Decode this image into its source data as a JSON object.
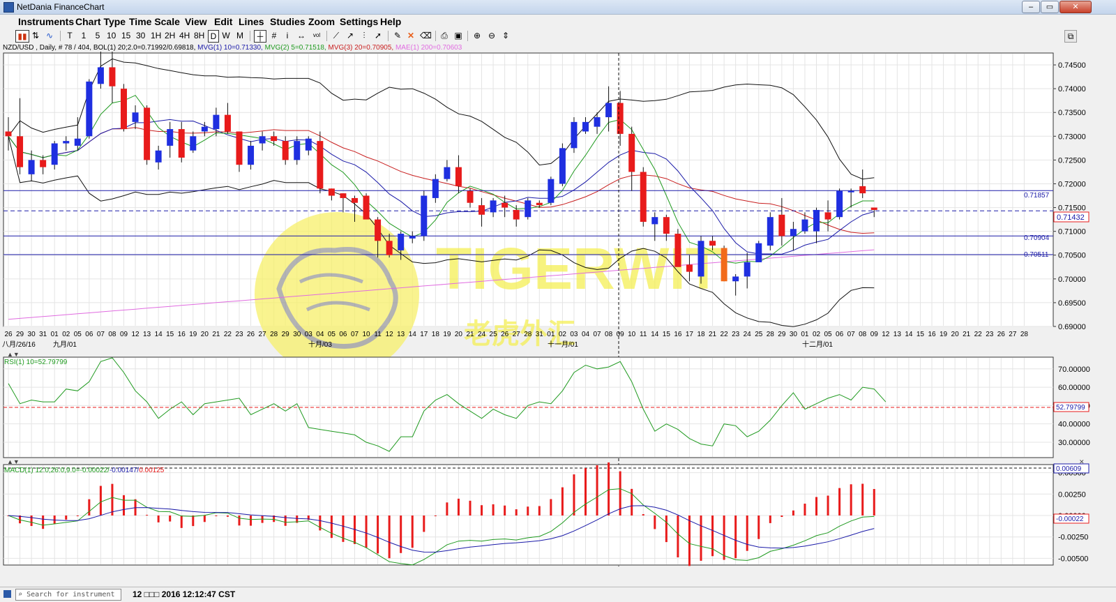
{
  "window": {
    "title": "NetDania FinanceChart",
    "buttons": [
      "–",
      "▭",
      "✕"
    ]
  },
  "menu": [
    "Instruments",
    "Chart Type",
    "Time Scale",
    "View",
    "Edit",
    "Lines",
    "Studies",
    "Zoom",
    "Settings",
    "Help"
  ],
  "toolbar": {
    "timeframes": [
      "T",
      "1",
      "5",
      "10",
      "15",
      "30",
      "1H",
      "2H",
      "4H",
      "8H",
      "D",
      "W",
      "M"
    ],
    "selected_timeframe": "D"
  },
  "legend": {
    "instrument": "NZD/USD , Daily, # 78 / 404, BOL(1) 20;2.0=0.71992/0.69818,",
    "mvg1": "MVG(1) 10=0.71330,",
    "mvg2": "MVG(2) 5=0.71518,",
    "mvg3": "MVG(3) 20=0.70905,",
    "mae": "MAE(1) 200=0.70603"
  },
  "colors": {
    "up_candle": "#1f2fe0",
    "down_candle": "#e81b1b",
    "orange_candle": "#f26b1b",
    "mvg1": "#1a1aa8",
    "mvg2": "#1f9a1f",
    "mvg3": "#c81e1e",
    "mae": "#e06be0",
    "boll": "#111111",
    "watermark": "#f5ef55"
  },
  "watermark": {
    "brand": "TIGERWIT",
    "subtitle": "老虎外汇"
  },
  "price_axis": {
    "ticks": [
      "0.74500",
      "0.74000",
      "0.73500",
      "0.73000",
      "0.72500",
      "0.72000",
      "0.71500",
      "0.71000",
      "0.70500",
      "0.70000",
      "0.69500",
      "0.69000"
    ],
    "current": "0.71432",
    "levels": [
      "0.71857",
      "0.70904",
      "0.70511"
    ]
  },
  "x_axis": {
    "days": [
      "26",
      "29",
      "30",
      "31",
      "01",
      "02",
      "05",
      "06",
      "07",
      "08",
      "09",
      "12",
      "13",
      "14",
      "15",
      "16",
      "19",
      "20",
      "21",
      "22",
      "23",
      "26",
      "27",
      "28",
      "29",
      "30",
      "03",
      "04",
      "05",
      "06",
      "07",
      "10",
      "11",
      "12",
      "13",
      "14",
      "17",
      "18",
      "19",
      "20",
      "21",
      "24",
      "25",
      "26",
      "27",
      "28",
      "31",
      "01",
      "02",
      "03",
      "04",
      "07",
      "08",
      "09",
      "10",
      "11",
      "14",
      "15",
      "16",
      "17",
      "18",
      "21",
      "22",
      "23",
      "24",
      "25",
      "28",
      "29",
      "30",
      "01",
      "02",
      "05",
      "06",
      "07",
      "08",
      "09",
      "12",
      "13",
      "14",
      "15",
      "16",
      "19",
      "20",
      "21",
      "22",
      "23",
      "26",
      "27",
      "28"
    ],
    "months": [
      "八月/26/16",
      "九月/01",
      "十月/03",
      "十一月/01",
      "十二月/01"
    ]
  },
  "rsi": {
    "label": "RSI(1) 10=52.79799",
    "ticks": [
      "70.00000",
      "60.00000",
      "50.00000",
      "40.00000",
      "30.00000"
    ],
    "current": "52.79799"
  },
  "macd": {
    "label_main": "MACD(1) 12.0,26.0,9.0=-0.00022/",
    "label_signal": "-0.00147/",
    "label_hist": "0.00125",
    "ticks": [
      "0.00500",
      "0.00250",
      "0.00000",
      "-0.00250",
      "-0.00500"
    ],
    "current_top": "0.00609",
    "current": "-0.00022"
  },
  "status": {
    "search_placeholder": "Search for instrument",
    "datetime": "12 □□□ 2016 12:12:47 CST"
  },
  "chart_data": {
    "type": "candlestick",
    "instrument": "NZD/USD",
    "timeframe": "Daily",
    "ylim": [
      0.69,
      0.7475
    ],
    "candles": [
      {
        "o": 0.731,
        "h": 0.734,
        "l": 0.727,
        "c": 0.73
      },
      {
        "o": 0.73,
        "h": 0.738,
        "l": 0.722,
        "c": 0.7235
      },
      {
        "o": 0.722,
        "h": 0.727,
        "l": 0.7205,
        "c": 0.725
      },
      {
        "o": 0.725,
        "h": 0.726,
        "l": 0.722,
        "c": 0.7235
      },
      {
        "o": 0.724,
        "h": 0.729,
        "l": 0.723,
        "c": 0.7285
      },
      {
        "o": 0.7285,
        "h": 0.73,
        "l": 0.727,
        "c": 0.729
      },
      {
        "o": 0.728,
        "h": 0.734,
        "l": 0.727,
        "c": 0.7295
      },
      {
        "o": 0.73,
        "h": 0.742,
        "l": 0.7295,
        "c": 0.7415
      },
      {
        "o": 0.741,
        "h": 0.7485,
        "l": 0.74,
        "c": 0.7445
      },
      {
        "o": 0.7445,
        "h": 0.7485,
        "l": 0.737,
        "c": 0.7405
      },
      {
        "o": 0.74,
        "h": 0.741,
        "l": 0.731,
        "c": 0.7315
      },
      {
        "o": 0.733,
        "h": 0.7365,
        "l": 0.7315,
        "c": 0.735
      },
      {
        "o": 0.736,
        "h": 0.7365,
        "l": 0.724,
        "c": 0.725
      },
      {
        "o": 0.7245,
        "h": 0.728,
        "l": 0.723,
        "c": 0.727
      },
      {
        "o": 0.728,
        "h": 0.733,
        "l": 0.7255,
        "c": 0.7315
      },
      {
        "o": 0.7315,
        "h": 0.733,
        "l": 0.7245,
        "c": 0.7255
      },
      {
        "o": 0.727,
        "h": 0.731,
        "l": 0.7265,
        "c": 0.73
      },
      {
        "o": 0.731,
        "h": 0.733,
        "l": 0.73,
        "c": 0.732
      },
      {
        "o": 0.7315,
        "h": 0.736,
        "l": 0.73,
        "c": 0.7345
      },
      {
        "o": 0.7345,
        "h": 0.737,
        "l": 0.7305,
        "c": 0.731
      },
      {
        "o": 0.731,
        "h": 0.731,
        "l": 0.7225,
        "c": 0.724
      },
      {
        "o": 0.724,
        "h": 0.729,
        "l": 0.723,
        "c": 0.728
      },
      {
        "o": 0.7285,
        "h": 0.731,
        "l": 0.727,
        "c": 0.73
      },
      {
        "o": 0.73,
        "h": 0.731,
        "l": 0.728,
        "c": 0.729
      },
      {
        "o": 0.729,
        "h": 0.73,
        "l": 0.724,
        "c": 0.725
      },
      {
        "o": 0.725,
        "h": 0.73,
        "l": 0.724,
        "c": 0.729
      },
      {
        "o": 0.727,
        "h": 0.73,
        "l": 0.726,
        "c": 0.7295
      },
      {
        "o": 0.729,
        "h": 0.731,
        "l": 0.718,
        "c": 0.719
      },
      {
        "o": 0.719,
        "h": 0.719,
        "l": 0.7165,
        "c": 0.7175
      },
      {
        "o": 0.718,
        "h": 0.718,
        "l": 0.714,
        "c": 0.717
      },
      {
        "o": 0.717,
        "h": 0.7175,
        "l": 0.712,
        "c": 0.716
      },
      {
        "o": 0.7175,
        "h": 0.718,
        "l": 0.713,
        "c": 0.7125
      },
      {
        "o": 0.7125,
        "h": 0.713,
        "l": 0.7045,
        "c": 0.708
      },
      {
        "o": 0.708,
        "h": 0.7095,
        "l": 0.7045,
        "c": 0.705
      },
      {
        "o": 0.706,
        "h": 0.71,
        "l": 0.704,
        "c": 0.7095
      },
      {
        "o": 0.7085,
        "h": 0.71,
        "l": 0.7075,
        "c": 0.709
      },
      {
        "o": 0.709,
        "h": 0.7185,
        "l": 0.708,
        "c": 0.7175
      },
      {
        "o": 0.717,
        "h": 0.722,
        "l": 0.716,
        "c": 0.721
      },
      {
        "o": 0.721,
        "h": 0.725,
        "l": 0.7205,
        "c": 0.7235
      },
      {
        "o": 0.7235,
        "h": 0.726,
        "l": 0.718,
        "c": 0.7195
      },
      {
        "o": 0.7185,
        "h": 0.719,
        "l": 0.715,
        "c": 0.716
      },
      {
        "o": 0.7155,
        "h": 0.717,
        "l": 0.711,
        "c": 0.7135
      },
      {
        "o": 0.714,
        "h": 0.717,
        "l": 0.713,
        "c": 0.7165
      },
      {
        "o": 0.716,
        "h": 0.7175,
        "l": 0.713,
        "c": 0.715
      },
      {
        "o": 0.7145,
        "h": 0.7155,
        "l": 0.711,
        "c": 0.7125
      },
      {
        "o": 0.713,
        "h": 0.717,
        "l": 0.7125,
        "c": 0.7165
      },
      {
        "o": 0.716,
        "h": 0.7165,
        "l": 0.715,
        "c": 0.7155
      },
      {
        "o": 0.716,
        "h": 0.7215,
        "l": 0.7155,
        "c": 0.721
      },
      {
        "o": 0.72,
        "h": 0.7285,
        "l": 0.7195,
        "c": 0.7275
      },
      {
        "o": 0.7275,
        "h": 0.734,
        "l": 0.7265,
        "c": 0.733
      },
      {
        "o": 0.731,
        "h": 0.734,
        "l": 0.7305,
        "c": 0.733
      },
      {
        "o": 0.732,
        "h": 0.735,
        "l": 0.7305,
        "c": 0.734
      },
      {
        "o": 0.734,
        "h": 0.7405,
        "l": 0.731,
        "c": 0.737
      },
      {
        "o": 0.737,
        "h": 0.7395,
        "l": 0.728,
        "c": 0.7305
      },
      {
        "o": 0.7305,
        "h": 0.732,
        "l": 0.7185,
        "c": 0.7225
      },
      {
        "o": 0.7225,
        "h": 0.7235,
        "l": 0.711,
        "c": 0.712
      },
      {
        "o": 0.7115,
        "h": 0.714,
        "l": 0.708,
        "c": 0.713
      },
      {
        "o": 0.713,
        "h": 0.7135,
        "l": 0.708,
        "c": 0.7095
      },
      {
        "o": 0.7095,
        "h": 0.7105,
        "l": 0.704,
        "c": 0.7025
      },
      {
        "o": 0.703,
        "h": 0.705,
        "l": 0.6995,
        "c": 0.7015
      },
      {
        "o": 0.7005,
        "h": 0.709,
        "l": 0.699,
        "c": 0.708
      },
      {
        "o": 0.708,
        "h": 0.709,
        "l": 0.706,
        "c": 0.707
      },
      {
        "o": 0.7065,
        "h": 0.707,
        "l": 0.6995,
        "c": 0.6995
      },
      {
        "o": 0.6995,
        "h": 0.701,
        "l": 0.6965,
        "c": 0.7005
      },
      {
        "o": 0.7005,
        "h": 0.7055,
        "l": 0.698,
        "c": 0.7035
      },
      {
        "o": 0.7035,
        "h": 0.708,
        "l": 0.7045,
        "c": 0.7075
      },
      {
        "o": 0.707,
        "h": 0.714,
        "l": 0.706,
        "c": 0.713
      },
      {
        "o": 0.7135,
        "h": 0.717,
        "l": 0.707,
        "c": 0.709
      },
      {
        "o": 0.709,
        "h": 0.712,
        "l": 0.706,
        "c": 0.7105
      },
      {
        "o": 0.71,
        "h": 0.714,
        "l": 0.7095,
        "c": 0.7125
      },
      {
        "o": 0.71,
        "h": 0.715,
        "l": 0.7075,
        "c": 0.7145
      },
      {
        "o": 0.714,
        "h": 0.7165,
        "l": 0.71,
        "c": 0.7125
      },
      {
        "o": 0.713,
        "h": 0.719,
        "l": 0.7125,
        "c": 0.7185
      },
      {
        "o": 0.7185,
        "h": 0.719,
        "l": 0.715,
        "c": 0.7185
      },
      {
        "o": 0.7195,
        "h": 0.723,
        "l": 0.717,
        "c": 0.718
      },
      {
        "o": 0.715,
        "h": 0.715,
        "l": 0.713,
        "c": 0.7145
      }
    ],
    "rsi_values": [
      62,
      51,
      53,
      52,
      52,
      59,
      58,
      63,
      74,
      76,
      68,
      58,
      52,
      43,
      48,
      52,
      45,
      51,
      52,
      53,
      54,
      45,
      48,
      51,
      47,
      51,
      38,
      37,
      36,
      35,
      34,
      30,
      28,
      25,
      33,
      33,
      47,
      53,
      56,
      51,
      47,
      43,
      48,
      45,
      43,
      50,
      52,
      51,
      58,
      68,
      72,
      70,
      71,
      74,
      63,
      48,
      36,
      40,
      37,
      32,
      29,
      28,
      40,
      39,
      33,
      36,
      42,
      50,
      57,
      48,
      51,
      54,
      56,
      53,
      60,
      59,
      52
    ]
  }
}
